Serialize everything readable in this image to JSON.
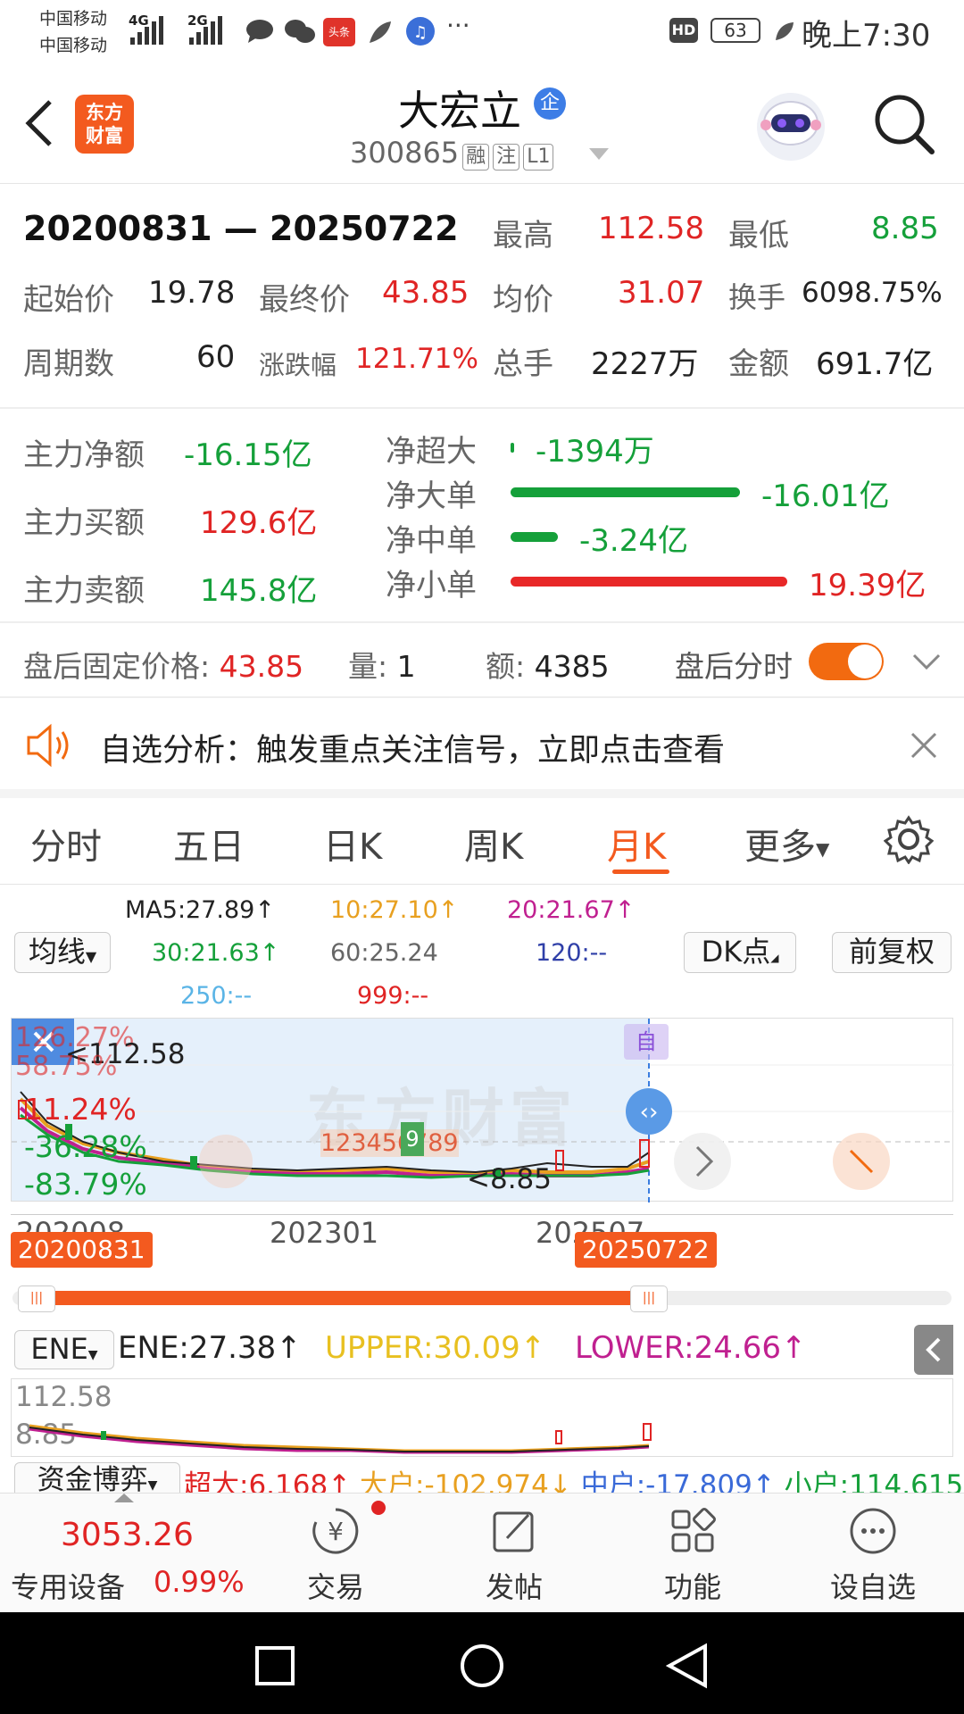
{
  "status_bar": {
    "carrier1": "中国移动",
    "carrier2": "中国移动",
    "net1": "4G",
    "net2": "2G",
    "toutiao": "头条",
    "more": "···",
    "hd": "HD",
    "battery": "63",
    "time": "晚上7:30"
  },
  "header": {
    "logo_line1": "东方",
    "logo_line2": "财富",
    "stock_name": "大宏立",
    "badge": "企",
    "code": "300865",
    "tag1": "融",
    "tag2": "注",
    "tag3": "L1"
  },
  "stats": {
    "range_start": "20200831",
    "range_sep": "—",
    "range_end": "20250722",
    "high_label": "最高",
    "high": "112.58",
    "low_label": "最低",
    "low": "8.85",
    "open_label": "起始价",
    "open": "19.78",
    "close_label": "最终价",
    "close": "43.85",
    "avg_label": "均价",
    "avg": "31.07",
    "turnover_label": "换手",
    "turnover": "6098.75%",
    "periods_label": "周期数",
    "periods": "60",
    "change_label": "涨跌幅",
    "change": "121.71%",
    "volume_label": "总手",
    "volume": "2227万",
    "amount_label": "金额",
    "amount": "691.7亿"
  },
  "flows": {
    "net_main_label": "主力净额",
    "net_main": "-16.15亿",
    "buy_main_label": "主力买额",
    "buy_main": "129.6亿",
    "sell_main_label": "主力卖额",
    "sell_main": "145.8亿",
    "items": [
      {
        "label": "净超大",
        "value": "-1394万",
        "fraction": 0.01,
        "color": "#15a03a"
      },
      {
        "label": "净大单",
        "value": "-16.01亿",
        "fraction": 0.83,
        "color": "#15a03a"
      },
      {
        "label": "净中单",
        "value": "-3.24亿",
        "fraction": 0.17,
        "color": "#15a03a"
      },
      {
        "label": "净小单",
        "value": "19.39亿",
        "fraction": 1.0,
        "color": "#e82828"
      }
    ]
  },
  "after_hours": {
    "price_label": "盘后固定价格:",
    "price": "43.85",
    "vol_label": "量:",
    "vol": "1",
    "amt_label": "额:",
    "amt": "4385",
    "toggle_label": "盘后分时"
  },
  "notice": {
    "text": "自选分析：触发重点关注信号，立即点击查看"
  },
  "tabs": [
    {
      "label": "分时"
    },
    {
      "label": "五日"
    },
    {
      "label": "日K"
    },
    {
      "label": "周K"
    },
    {
      "label": "月K",
      "active": true
    },
    {
      "label": "更多"
    }
  ],
  "indicators": {
    "ma_select": "均线",
    "ma5": "MA5:27.89↑",
    "ma10": "10:27.10↑",
    "ma20": "20:21.67↑",
    "ma30": "30:21.63↑",
    "ma60": "60:25.24",
    "ma120": "120:--",
    "ma250": "250:--",
    "ma999": "999:--",
    "dk": "DK点",
    "adjust": "前复权"
  },
  "chart": {
    "labels": [
      "126.27%",
      "58.75%",
      "11.24%",
      "-36.28%",
      "-83.79%"
    ],
    "high_marker": "112.58",
    "low_marker": "8.85",
    "self_marker": "自",
    "nine_badge": "9",
    "seq_text": "123456789",
    "x_ticks": [
      "202008",
      "202301",
      "202507"
    ],
    "range_start": "20200831",
    "range_end": "20250722",
    "watermark": "东方财富"
  },
  "ene": {
    "select": "ENE",
    "ene": "ENE:27.38↑",
    "upper": "UPPER:30.09↑",
    "lower": "LOWER:24.66↑",
    "max": "112.58",
    "min": "8.85"
  },
  "capital": {
    "select": "资金博弈",
    "super": "超大:6.168↑",
    "big": "大户:-102.974↓",
    "mid": "中户:-17.809↑",
    "small": "小户:114.615↓"
  },
  "bottom_nav": {
    "index_value": "3053.26",
    "sector": "专用设备",
    "sector_change": "0.99%",
    "items": [
      {
        "label": "交易",
        "icon": "yen-icon"
      },
      {
        "label": "发帖",
        "icon": "edit-icon"
      },
      {
        "label": "功能",
        "icon": "grid-icon"
      },
      {
        "label": "设自选",
        "icon": "more-circle-icon"
      }
    ]
  },
  "chart_data": {
    "type": "candlestick",
    "series": [
      {
        "name": "MA5",
        "values": [
          27.89
        ]
      },
      {
        "name": "10",
        "values": [
          27.1
        ]
      },
      {
        "name": "20",
        "values": [
          21.67
        ]
      },
      {
        "name": "30",
        "values": [
          21.63
        ]
      },
      {
        "name": "60",
        "values": [
          25.24
        ]
      }
    ],
    "high": 112.58,
    "low": 8.85,
    "x_ticks": [
      "202008",
      "202301",
      "202507"
    ]
  }
}
